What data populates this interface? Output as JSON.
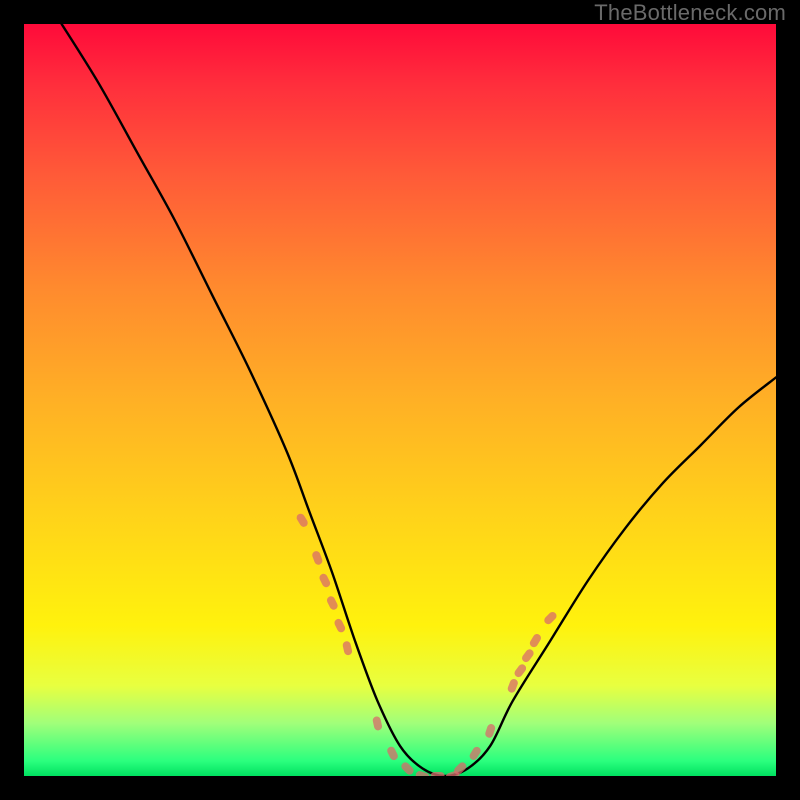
{
  "watermark": "TheBottleneck.com",
  "colors": {
    "curve": "#000000",
    "dots": "#d86b6b",
    "frame": "#000000"
  },
  "chart_data": {
    "type": "line",
    "title": "",
    "xlabel": "",
    "ylabel": "",
    "xlim": [
      0,
      100
    ],
    "ylim": [
      0,
      100
    ],
    "grid": false,
    "legend": false,
    "series": [
      {
        "name": "bottleneck-curve",
        "x": [
          5,
          10,
          15,
          20,
          25,
          30,
          35,
          38,
          41,
          44,
          47,
          50,
          53,
          56,
          59,
          62,
          65,
          70,
          75,
          80,
          85,
          90,
          95,
          100
        ],
        "y": [
          100,
          92,
          83,
          74,
          64,
          54,
          43,
          35,
          27,
          18,
          10,
          4,
          1,
          0,
          1,
          4,
          10,
          18,
          26,
          33,
          39,
          44,
          49,
          53
        ]
      }
    ],
    "dots": {
      "name": "highlight-dots",
      "x": [
        37,
        39,
        40,
        41,
        42,
        43,
        47,
        49,
        51,
        53,
        55,
        57,
        58,
        60,
        62,
        65,
        66,
        67,
        68,
        70
      ],
      "y": [
        34,
        29,
        26,
        23,
        20,
        17,
        7,
        3,
        1,
        0,
        0,
        0,
        1,
        3,
        6,
        12,
        14,
        16,
        18,
        21
      ]
    }
  }
}
